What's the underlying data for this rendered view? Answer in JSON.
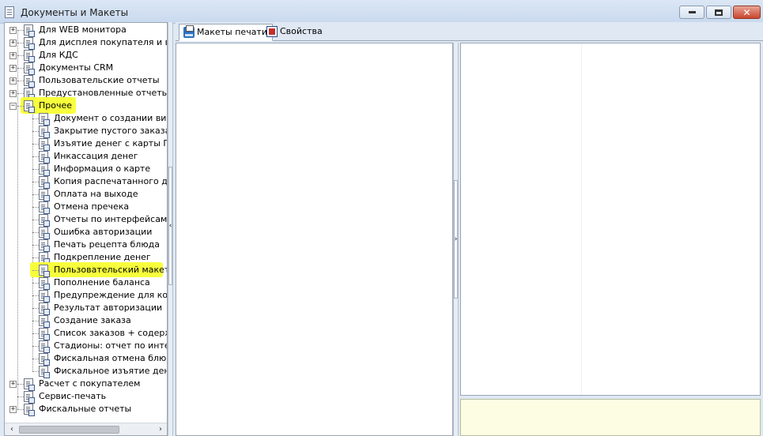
{
  "window": {
    "title": "Документы и Макеты",
    "minimize_glyph": "",
    "close_glyph": "✕"
  },
  "tree": {
    "items": [
      {
        "label": "Для WEB монитора",
        "level": 0,
        "expander": "+",
        "highlighted": false
      },
      {
        "label": "Для дисплея покупателя и виде",
        "level": 0,
        "expander": "+",
        "highlighted": false
      },
      {
        "label": "Для КДС",
        "level": 0,
        "expander": "+",
        "highlighted": false
      },
      {
        "label": "Документы CRM",
        "level": 0,
        "expander": "+",
        "highlighted": false
      },
      {
        "label": "Пользовательские отчеты",
        "level": 0,
        "expander": "+",
        "highlighted": false
      },
      {
        "label": "Предустановленные отчеты",
        "level": 0,
        "expander": "+",
        "highlighted": false
      },
      {
        "label": "Прочее",
        "level": 0,
        "expander": "−",
        "highlighted": true
      },
      {
        "label": "Документ о создании визит",
        "level": 1,
        "highlighted": false
      },
      {
        "label": "Закрытие пустого заказа",
        "level": 1,
        "highlighted": false
      },
      {
        "label": "Изъятие денег с карты ПДС",
        "level": 1,
        "highlighted": false
      },
      {
        "label": "Инкассация денег",
        "level": 1,
        "highlighted": false
      },
      {
        "label": "Информация о карте",
        "level": 1,
        "highlighted": false
      },
      {
        "label": "Копия распечатанного доку",
        "level": 1,
        "highlighted": false
      },
      {
        "label": "Оплата на выходе",
        "level": 1,
        "highlighted": false
      },
      {
        "label": "Отмена пречека",
        "level": 1,
        "highlighted": false
      },
      {
        "label": "Отчеты по интерфейсам",
        "level": 1,
        "highlighted": false
      },
      {
        "label": "Ошибка авторизации",
        "level": 1,
        "highlighted": false
      },
      {
        "label": "Печать рецепта блюда",
        "level": 1,
        "highlighted": false
      },
      {
        "label": "Подкрепление денег",
        "level": 1,
        "highlighted": false
      },
      {
        "label": "Пользовательский макет",
        "level": 1,
        "highlighted": true
      },
      {
        "label": "Пополнение баланса",
        "level": 1,
        "highlighted": false
      },
      {
        "label": "Предупреждение для контро",
        "level": 1,
        "highlighted": false
      },
      {
        "label": "Результат авторизации",
        "level": 1,
        "highlighted": false
      },
      {
        "label": "Создание заказа",
        "level": 1,
        "highlighted": false
      },
      {
        "label": "Список заказов + содержим",
        "level": 1,
        "highlighted": false
      },
      {
        "label": "Стадионы: отчет по интерфе",
        "level": 1,
        "highlighted": false
      },
      {
        "label": "Фискальная отмена блюда",
        "level": 1,
        "highlighted": false
      },
      {
        "label": "Фискальное изъятие денег",
        "level": 1,
        "highlighted": false
      },
      {
        "label": "Расчет с покупателем",
        "level": 0,
        "expander": "+",
        "highlighted": false
      },
      {
        "label": "Сервис-печать",
        "level": 0,
        "expander": "",
        "highlighted": false
      },
      {
        "label": "Фискальные отчеты",
        "level": 0,
        "expander": "+",
        "highlighted": false
      }
    ],
    "scroll_left_glyph": "‹",
    "scroll_right_glyph": "›"
  },
  "tabs": [
    {
      "label": "Макеты печати",
      "active": true,
      "icon": "printer-icon"
    },
    {
      "label": "Свойства",
      "active": false,
      "icon": "properties-icon"
    }
  ],
  "splitters": {
    "left_glyph": "‹",
    "right_glyph": "›"
  },
  "colors": {
    "highlight": "#f7ff3c",
    "preview_bg": "#fdfde4"
  }
}
